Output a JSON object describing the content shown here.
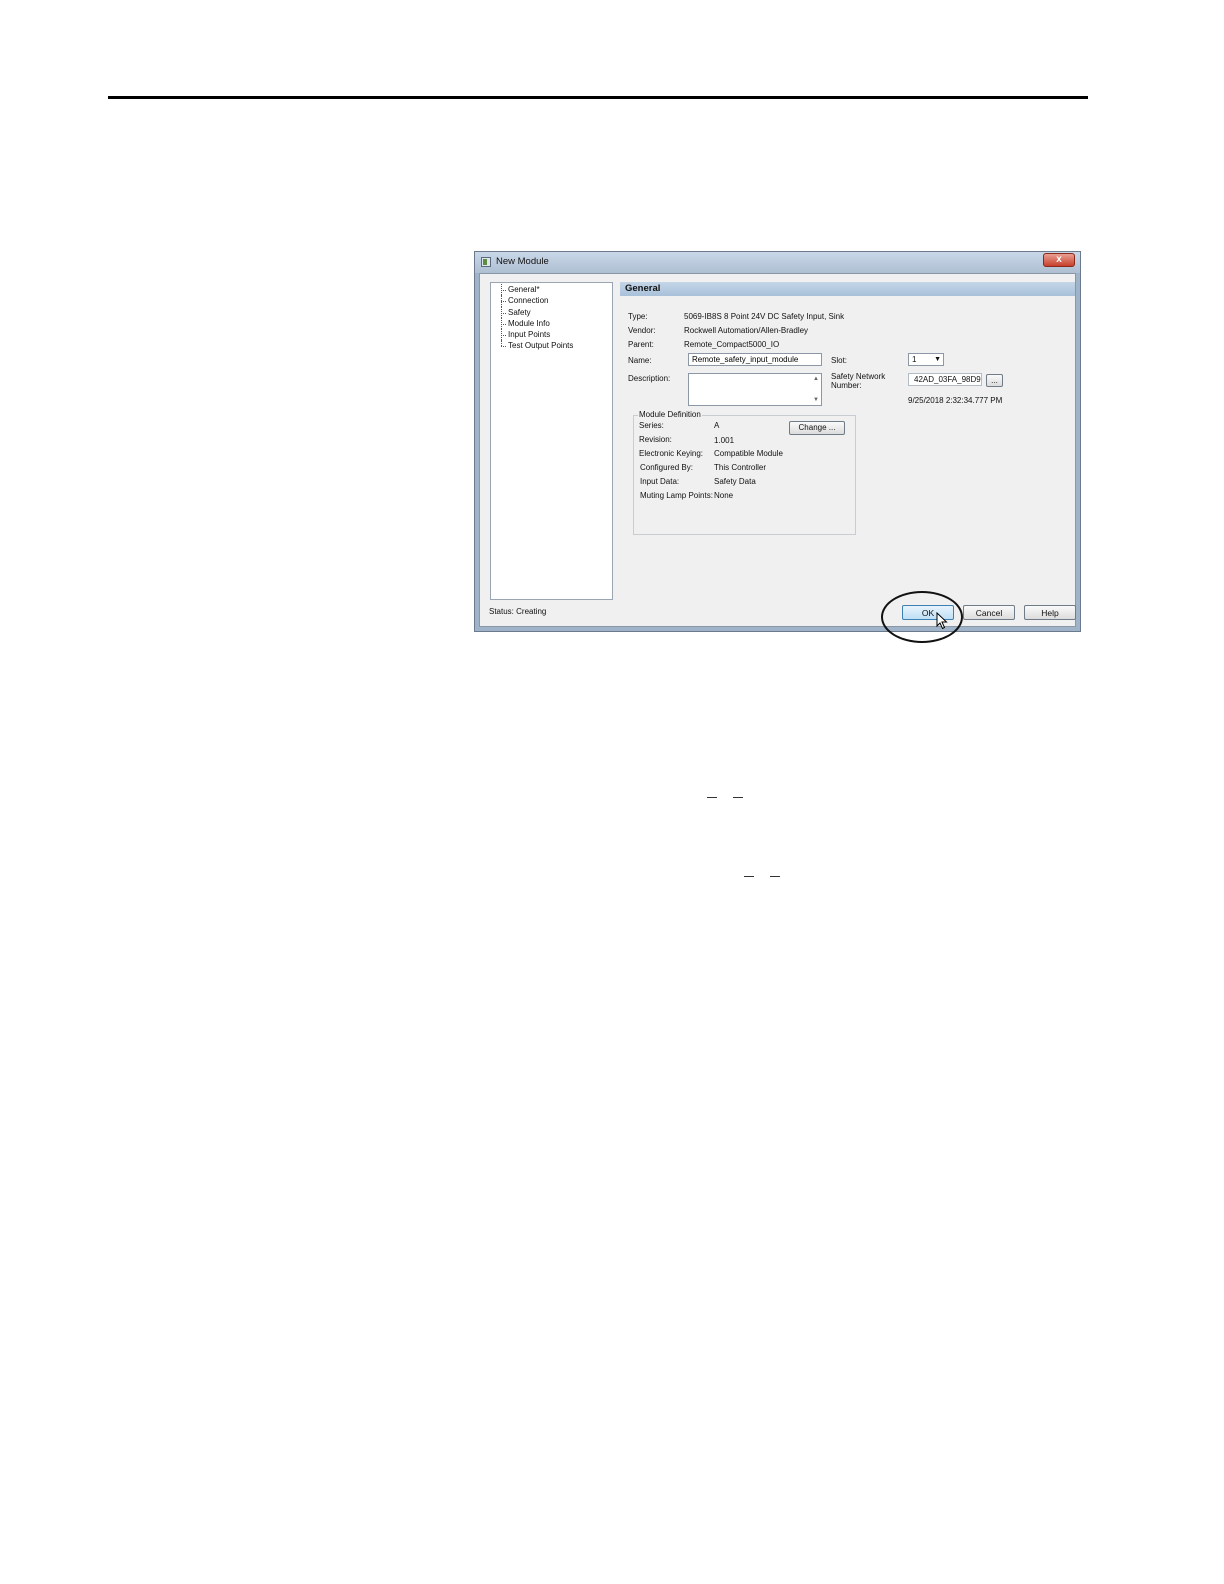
{
  "window": {
    "title": "New Module",
    "close_glyph": "x"
  },
  "nav": {
    "items": [
      {
        "label": "General*"
      },
      {
        "label": "Connection"
      },
      {
        "label": "Safety"
      },
      {
        "label": "Module Info"
      },
      {
        "label": "Input Points"
      },
      {
        "label": "Test Output Points"
      }
    ]
  },
  "general": {
    "header": "General",
    "type_label": "Type:",
    "type_value": "5069-IB8S 8 Point 24V DC Safety Input, Sink",
    "vendor_label": "Vendor:",
    "vendor_value": "Rockwell Automation/Allen-Bradley",
    "parent_label": "Parent:",
    "parent_value": "Remote_Compact5000_IO",
    "name_label": "Name:",
    "name_value": "Remote_safety_input_module",
    "description_label": "Description:",
    "description_value": "",
    "slot_label": "Slot:",
    "slot_value": "1",
    "snn_label_line1": "Safety Network",
    "snn_label_line2": "Number:",
    "snn_value": "42AD_03FA_98D9",
    "snn_button_label": "...",
    "timestamp": "9/25/2018 2:32:34.777 PM"
  },
  "module_definition": {
    "legend": "Module Definition",
    "change_button_label": "Change ...",
    "rows": [
      {
        "label": "Series:",
        "value": "A"
      },
      {
        "label": "Revision:",
        "value": "1.001"
      },
      {
        "label": "Electronic Keying:",
        "value": "Compatible Module"
      },
      {
        "label": "Configured By:",
        "value": "This Controller"
      },
      {
        "label": "Input Data:",
        "value": "Safety Data"
      },
      {
        "label": "Muting Lamp Points:",
        "value": "None"
      }
    ]
  },
  "status": {
    "text": "Status:  Creating"
  },
  "buttons": {
    "ok_label": "OK",
    "cancel_label": "Cancel",
    "help_label": "Help"
  },
  "icons": {
    "window_icon": "app-icon",
    "close": "close-icon",
    "dropdown": "chevron-down-icon",
    "cursor": "mouse-pointer-icon",
    "annotation": "highlight-ellipse"
  }
}
